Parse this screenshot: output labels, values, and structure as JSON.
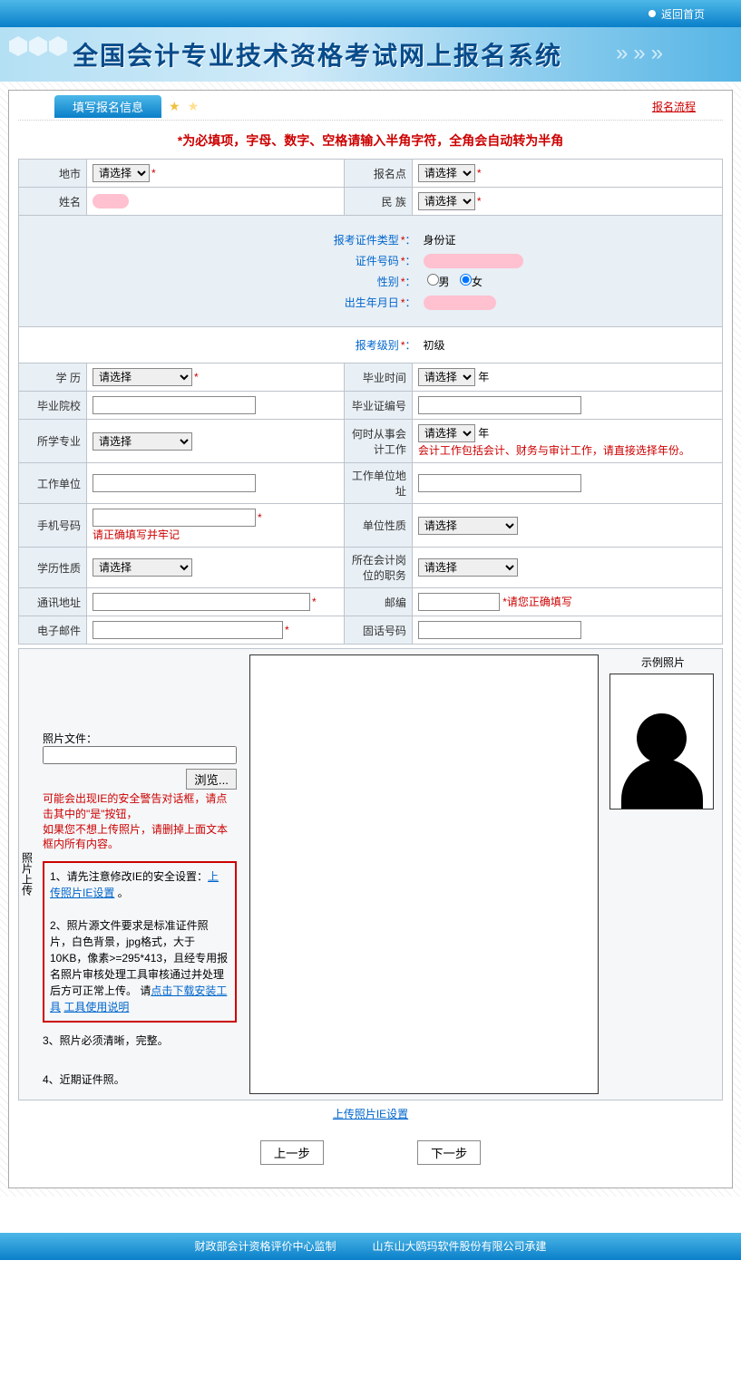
{
  "top_link": "返回首页",
  "banner_title": "全国会计专业技术资格考试网上报名系统",
  "tab_label": "填写报名信息",
  "flow_link": "报名流程",
  "instruction": "*为必填项，字母、数字、空格请输入半角字符，全角会自动转为半角",
  "labels": {
    "city": "地市",
    "point": "报名点",
    "name": "姓名",
    "ethnic": "民 族",
    "id_type": "报考证件类型",
    "id_type_val": "身份证",
    "id_no": "证件号码",
    "gender": "性别",
    "gender_m": "男",
    "gender_f": "女",
    "birth": "出生年月日",
    "level": "报考级别",
    "level_val": "初级",
    "edu": "学 历",
    "grad_time": "毕业时间",
    "year_suffix": "年",
    "school": "毕业院校",
    "cert_no": "毕业证编号",
    "major": "所学专业",
    "work_since": "何时从事会计工作",
    "work_since_hint": "会计工作包括会计、财务与审计工作，请直接选择年份。",
    "work_unit": "工作单位",
    "work_addr": "工作单位地址",
    "mobile": "手机号码",
    "mobile_hint": "请正确填写并牢记",
    "unit_type": "单位性质",
    "edu_type": "学历性质",
    "position": "所在会计岗位的职务",
    "addr": "通讯地址",
    "zip": "邮编",
    "zip_hint": "*请您正确填写",
    "email": "电子邮件",
    "phone": "固话号码"
  },
  "select_placeholder": "请选择",
  "photo": {
    "side_label": "照片上传",
    "file_label": "照片文件：",
    "browse": "浏览...",
    "warn1": "可能会出现IE的安全警告对话框，请点击其中的\"是\"按钮，",
    "warn2": "如果您不想上传照片，请删掉上面文本框内所有内容。",
    "tip1a": "1、请先注意修改IE的安全设置：",
    "tip1_link": "上传照片IE设置",
    "tip2": "2、照片源文件要求是标准证件照片，白色背景，jpg格式，大于10KB，像素>=295*413，且经专用报名照片审核处理工具审核通过并处理后方可正常上传。 请",
    "tip2_link1": "点击下载安装工具",
    "tip2_link2": "工具使用说明",
    "tip3": "3、照片必须清晰，完整。",
    "tip4": "4、近期证件照。",
    "example_label": "示例照片",
    "ie_link": "上传照片IE设置"
  },
  "buttons": {
    "prev": "上一步",
    "next": "下一步"
  },
  "footer": {
    "left": "财政部会计资格评价中心监制",
    "right": "山东山大鸥玛软件股份有限公司承建"
  }
}
